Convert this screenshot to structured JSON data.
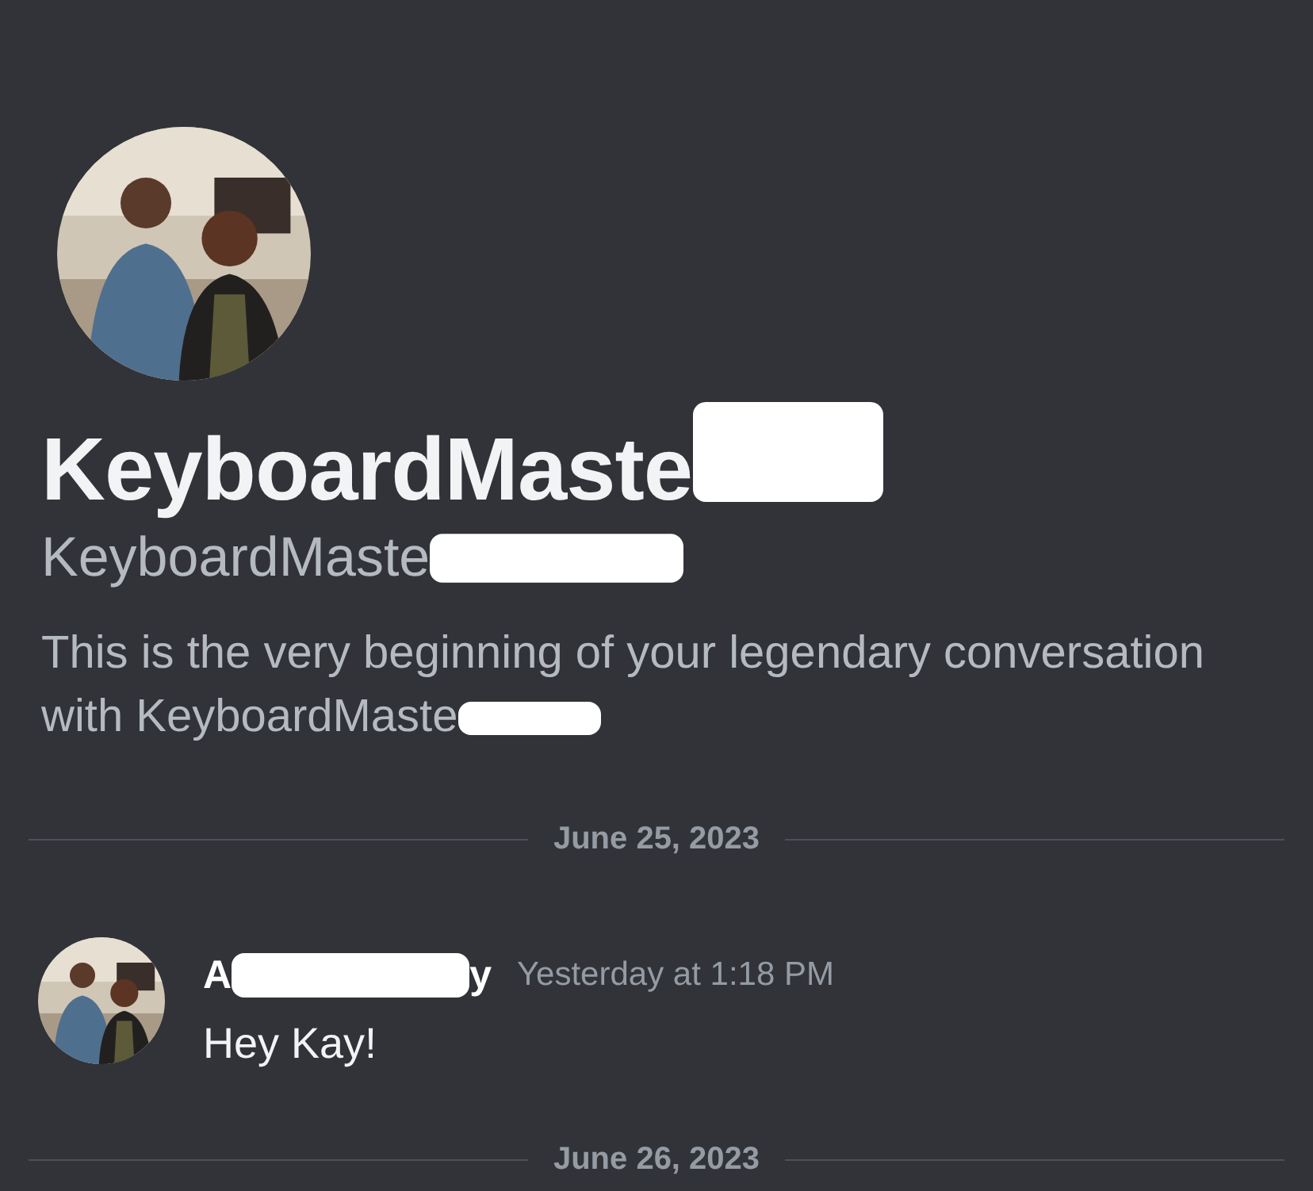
{
  "profile": {
    "display_name": "KeyboardMaste",
    "username": "KeyboardMaste",
    "intro_start": "This is the very beginning of your legendary conversation with KeyboardMaste"
  },
  "messages": [
    {
      "kind": "divider",
      "date": "June 25, 2023"
    },
    {
      "kind": "message",
      "author_start": "A",
      "author_end": "y",
      "timestamp": "Yesterday at 1:18 PM",
      "text": "Hey Kay!"
    },
    {
      "kind": "divider",
      "date": "June 26, 2023"
    }
  ]
}
